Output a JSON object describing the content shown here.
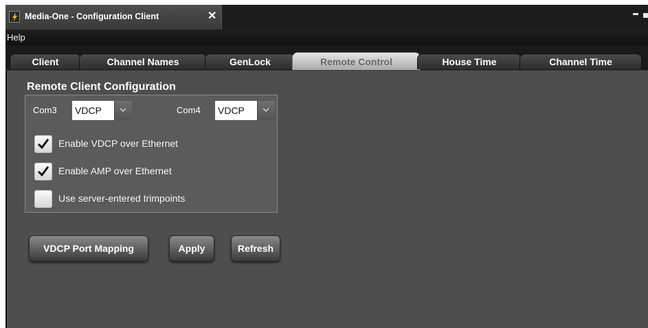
{
  "window": {
    "title": "Media-One - Configuration Client",
    "close_glyph": "✕",
    "controls": [
      "minimize-icon",
      "maximize-icon"
    ]
  },
  "menu": {
    "items": [
      {
        "label": "Help"
      }
    ]
  },
  "tabs": [
    {
      "label": "Client",
      "active": false
    },
    {
      "label": "Channel Names",
      "active": false
    },
    {
      "label": "GenLock",
      "active": false
    },
    {
      "label": "Remote Control",
      "active": true
    },
    {
      "label": "House Time",
      "active": false
    },
    {
      "label": "Channel Time",
      "active": false
    }
  ],
  "remote": {
    "group_title": "Remote Client Configuration",
    "com3": {
      "label": "Com3",
      "value": "VDCP"
    },
    "com4": {
      "label": "Com4",
      "value": "VDCP"
    },
    "options": [
      {
        "label": "Enable VDCP over Ethernet",
        "checked": true
      },
      {
        "label": "Enable AMP over Ethernet",
        "checked": true
      },
      {
        "label": "Use server-entered trimpoints",
        "checked": false
      }
    ]
  },
  "buttons": {
    "vdcp_port_mapping": "VDCP Port Mapping",
    "apply": "Apply",
    "refresh": "Refresh"
  },
  "colors": {
    "background": "#4e4e4e",
    "group_panel": "#5b5b5b",
    "active_tab": "#d8d8d8",
    "title_bar": "#1c1c1c"
  }
}
